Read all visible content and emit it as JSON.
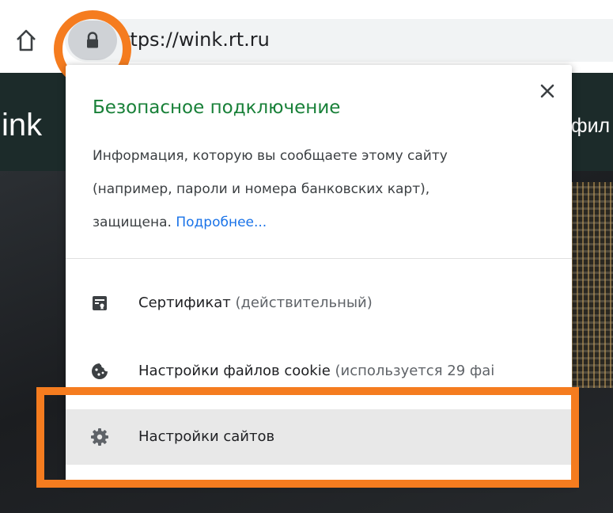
{
  "browser": {
    "url": "ttps://wink.rt.ru"
  },
  "site": {
    "logo_text": "ink",
    "nav_text": "фил"
  },
  "popup": {
    "title": "Безопасное подключение",
    "description_line1": "Информация, которую вы сообщаете этому сайту",
    "description_line2": "(например, пароли и номера банковских карт),",
    "description_line3": "защищена.",
    "learn_more": "Подробнее...",
    "items": [
      {
        "label": "Сертификат",
        "sub": "(действительный)",
        "icon": "certificate-icon"
      },
      {
        "label": "Настройки файлов cookie",
        "sub": "(используется 29 фаі",
        "icon": "cookie-icon"
      },
      {
        "label": "Настройки сайтов",
        "sub": "",
        "icon": "gear-icon"
      }
    ]
  },
  "colors": {
    "secure_green": "#188038",
    "link_blue": "#1a73e8",
    "highlight_orange": "#f57c1f"
  }
}
